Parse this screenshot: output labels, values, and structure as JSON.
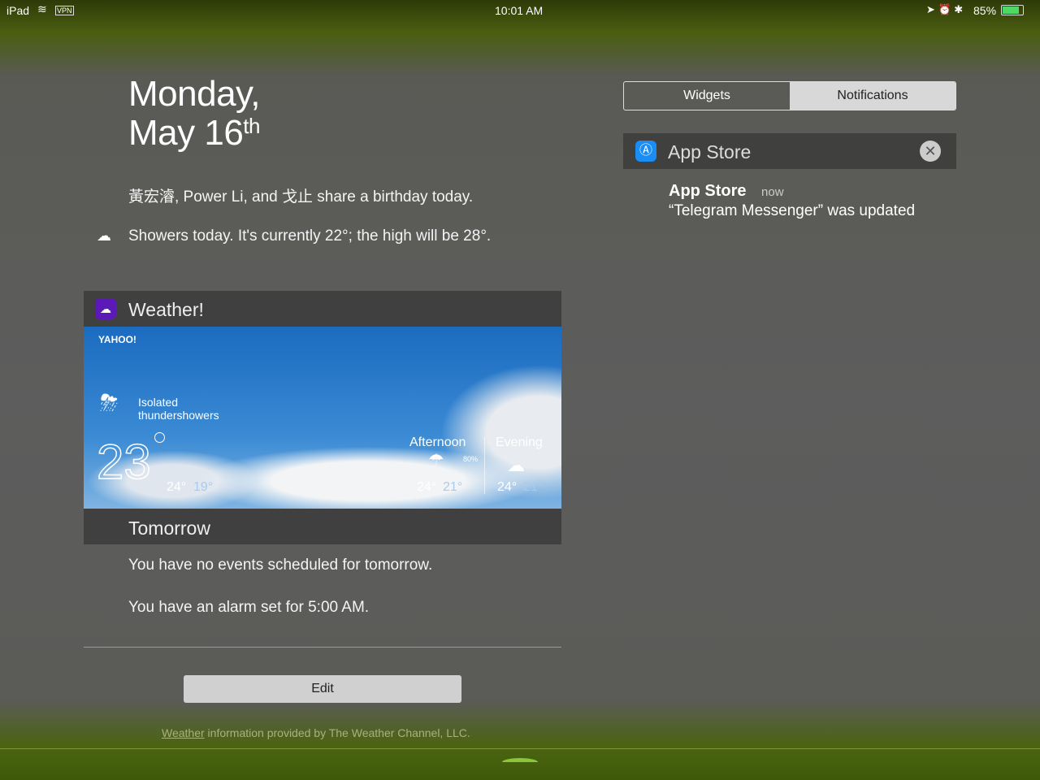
{
  "status": {
    "device": "iPad",
    "vpn": "VPN",
    "time": "10:01 AM",
    "battery": "85%"
  },
  "date": {
    "line1": "Monday,",
    "line2": "May 16",
    "suffix": "th"
  },
  "birthday": "黃宏濬, Power Li, and 戈止 share a birthday today.",
  "forecast": "Showers today. It's currently 22°; the high will be 28°.",
  "weather_widget": {
    "title": "Weather!",
    "brand": "YAHOO!",
    "condition_1": "Isolated",
    "condition_2": "thundershowers",
    "temp": "23",
    "high": "24°",
    "low": "19°",
    "periods": [
      {
        "label": "Afternoon",
        "precip": "80%",
        "high": "24°",
        "low": "21°"
      },
      {
        "label": "Evening",
        "high": "24°",
        "low": "21°"
      }
    ]
  },
  "tomorrow": {
    "title": "Tomorrow",
    "events": "You have no events scheduled for tomorrow.",
    "alarm": "You have an alarm set for 5:00 AM."
  },
  "edit_label": "Edit",
  "footer": {
    "link": "Weather",
    "text": " information provided by The Weather Channel, LLC."
  },
  "tabs": {
    "widgets": "Widgets",
    "notifications": "Notifications"
  },
  "notification_group": {
    "title": "App Store",
    "app": "App Store",
    "time": "now",
    "message": "“Telegram Messenger” was updated"
  }
}
